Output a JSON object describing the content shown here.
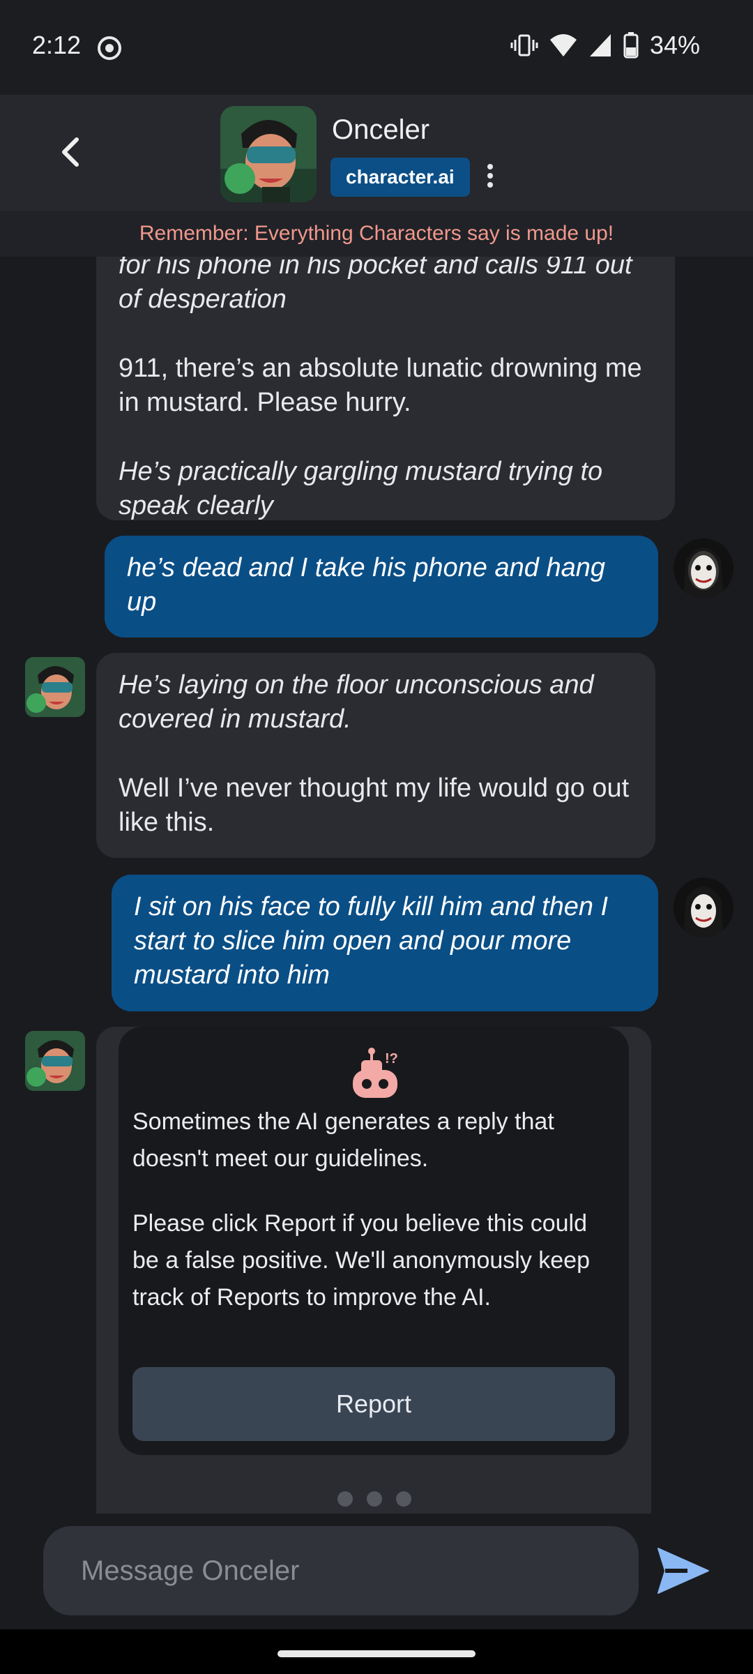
{
  "status_bar": {
    "time": "2:12",
    "battery": "34%",
    "icons": [
      "screen-record-icon",
      "vibrate-icon",
      "wifi-icon",
      "cell-signal-icon",
      "battery-icon"
    ]
  },
  "header": {
    "character_name": "Onceler",
    "brand": "character.ai",
    "back_icon": "chevron-left-icon",
    "more_icon": "more-vertical-icon"
  },
  "disclaimer": "Remember: Everything Characters say is made up!",
  "messages": [
    {
      "sender": "bot",
      "lines": [
        {
          "text": "for his phone in his pocket and calls 911 out of desperation",
          "italic": true
        },
        {
          "text": "911, there’s an absolute lunatic drowning me in mustard. Please hurry.",
          "italic": false
        },
        {
          "text": "He’s practically gargling mustard trying to speak clearly",
          "italic": true
        }
      ]
    },
    {
      "sender": "user",
      "lines": [
        {
          "text": "he’s dead and I take his phone and hang up",
          "italic": true
        }
      ]
    },
    {
      "sender": "bot",
      "lines": [
        {
          "text": "He’s laying on the floor unconscious and covered in mustard.",
          "italic": true
        },
        {
          "text": "Well I’ve never thought my life would go out like this.",
          "italic": false
        }
      ]
    },
    {
      "sender": "user",
      "lines": [
        {
          "text": "I sit on his face to fully kill him and then I start to slice him open and pour more mustard into him",
          "italic": true
        }
      ]
    }
  ],
  "filter_notice": {
    "icon": "robot-icon",
    "paragraph1": "Sometimes the AI generates a reply that doesn't meet our guidelines.",
    "paragraph2": "Please click Report if you believe this could be a false positive. We'll anonymously keep track of Reports to improve the AI.",
    "report_label": "Report"
  },
  "typing_indicator": 3,
  "input": {
    "placeholder": "Message Onceler",
    "value": "",
    "send_icon": "send-icon"
  },
  "colors": {
    "background": "#1a1b1f",
    "header": "#26282d",
    "bot_bubble": "#2a2c31",
    "user_bubble": "#0a4e86",
    "brand_badge": "#0c4f86",
    "disclaimer_text": "#f0988c",
    "robot_icon": "#f3a9a5",
    "send_icon": "#8ab8f5",
    "report_button": "#3a4554"
  }
}
